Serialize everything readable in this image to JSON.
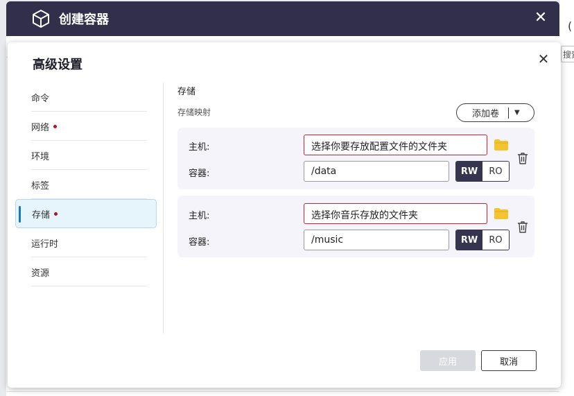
{
  "outer_dialog": {
    "title": "创建容器",
    "close_glyph": "✕"
  },
  "background": {
    "search_placeholder": "搜索",
    "glyph": "("
  },
  "advanced": {
    "title": "高级设置",
    "close_glyph": "✕",
    "sidebar": {
      "items": [
        {
          "label": "命令",
          "has_dot": false
        },
        {
          "label": "网络",
          "has_dot": true
        },
        {
          "label": "环境",
          "has_dot": false
        },
        {
          "label": "标签",
          "has_dot": false
        },
        {
          "label": "存储",
          "has_dot": true,
          "active": true
        },
        {
          "label": "运行时",
          "has_dot": false
        },
        {
          "label": "资源",
          "has_dot": false
        }
      ]
    },
    "storage": {
      "section_title": "存储",
      "mapping_label": "存储映射",
      "add_volume_label": "添加卷",
      "volumes": [
        {
          "host_label": "主机:",
          "host_placeholder": "选择你要存放配置文件的文件夹",
          "container_label": "容器:",
          "container_value": "/data",
          "rw_label": "RW",
          "ro_label": "RO",
          "mode": "RW"
        },
        {
          "host_label": "主机:",
          "host_placeholder": "选择你音乐存放的文件夹",
          "container_label": "容器:",
          "container_value": "/music",
          "rw_label": "RW",
          "ro_label": "RO",
          "mode": "RW"
        }
      ]
    },
    "footer": {
      "apply_label": "应用",
      "cancel_label": "取消"
    }
  },
  "colors": {
    "header_bg": "#322f4a",
    "accent_blue": "#1a78c2",
    "error_red": "#c4262e",
    "folder_yellow": "#f4c430",
    "toggle_dark": "#36344f"
  }
}
